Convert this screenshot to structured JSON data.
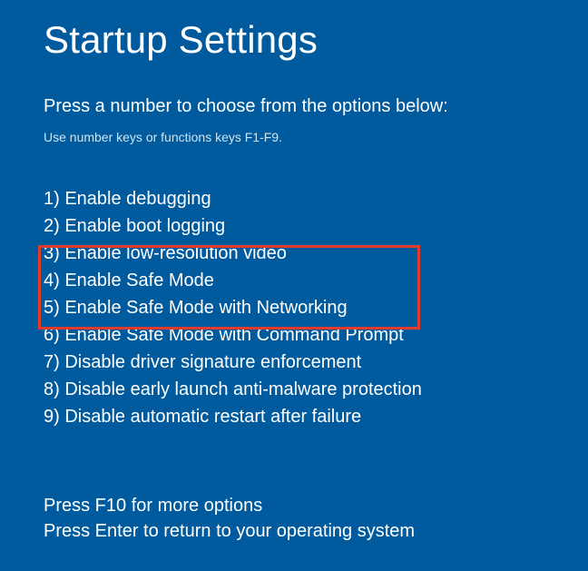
{
  "title": "Startup Settings",
  "instruction": "Press a number to choose from the options below:",
  "hint": "Use number keys or functions keys F1-F9.",
  "options": [
    "1) Enable debugging",
    "2) Enable boot logging",
    "3) Enable low-resolution video",
    "4) Enable Safe Mode",
    "5) Enable Safe Mode with Networking",
    "6) Enable Safe Mode with Command Prompt",
    "7) Disable driver signature enforcement",
    "8) Disable early launch anti-malware protection",
    "9) Disable automatic restart after failure"
  ],
  "footer": {
    "more": "Press F10 for more options",
    "return": "Press Enter to return to your operating system"
  }
}
